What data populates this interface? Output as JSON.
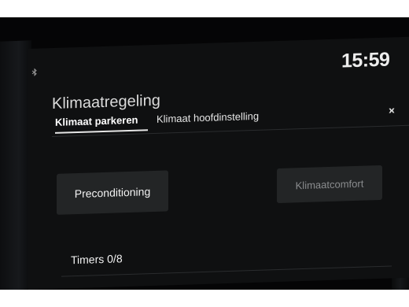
{
  "status": {
    "time": "15:59"
  },
  "header": {
    "title": "Klimaatregeling"
  },
  "tabs": [
    {
      "label": "Klimaat parkeren",
      "active": true
    },
    {
      "label": "Klimaat hoofdinstelling",
      "active": false
    }
  ],
  "more_label": "›‹",
  "buttons": {
    "preconditioning": "Preconditioning",
    "klimaatcomfort": "Klimaatcomfort"
  },
  "timers": {
    "label": "Timers 0/8"
  },
  "colors": {
    "screen_background": "#0f1011",
    "button_background": "#232526",
    "text_primary": "#f2f2f2",
    "text_disabled": "#8a8c8e"
  },
  "icons": {
    "bluetooth": "bluetooth-icon",
    "more": "chevron-icon"
  }
}
